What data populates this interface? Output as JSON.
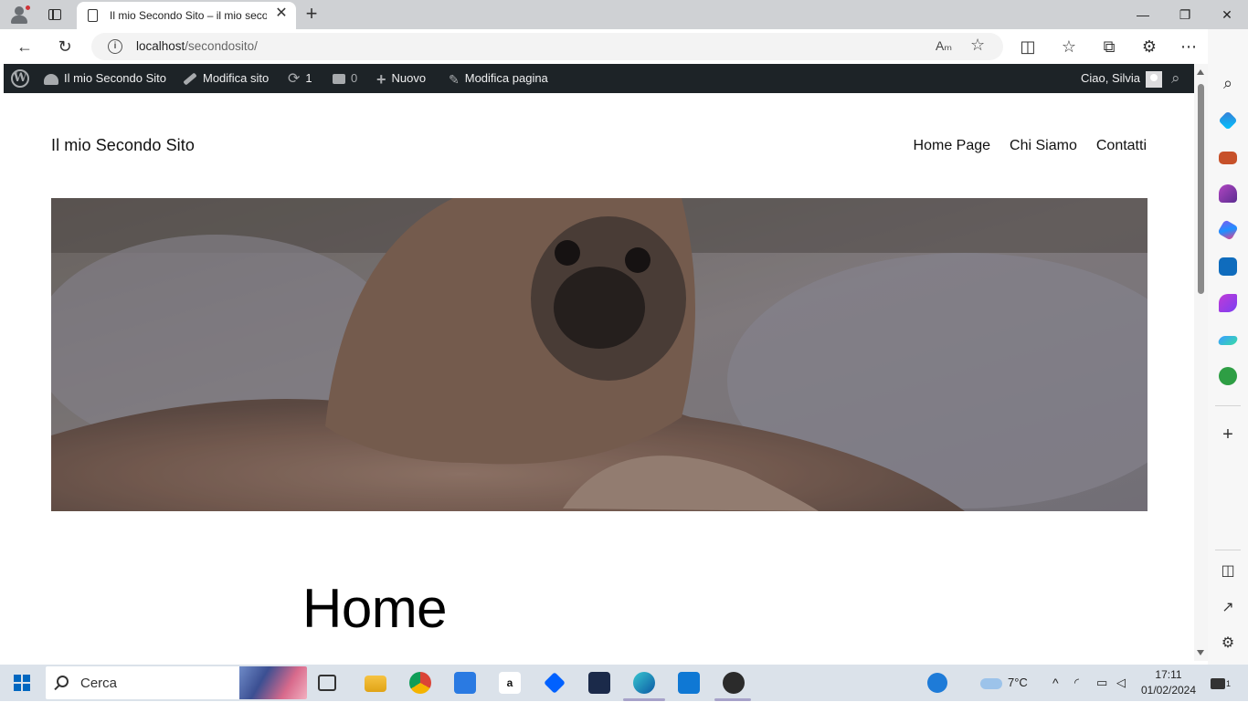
{
  "browser": {
    "tab_title": "Il mio Secondo Sito – il mio secondo sito",
    "url_host": "localhost",
    "url_path": "/secondosito/",
    "new_tab_symbol": "+",
    "close_symbol": "✕",
    "window_controls": {
      "minimize": "—",
      "maximize": "❐",
      "close": "✕"
    },
    "nav": {
      "back": "←",
      "refresh": "↻",
      "read_aloud": "Aₘ",
      "favorite": "☆"
    },
    "right_tools": {
      "split": "◫",
      "favorites": "☆",
      "collections": "⧉",
      "extensions": "⚙",
      "more": "⋯"
    }
  },
  "admin_bar": {
    "site_name": "Il mio Secondo Sito",
    "customize": "Modifica sito",
    "updates_count": "1",
    "comments_count": "0",
    "new": "Nuovo",
    "edit_page": "Modifica pagina",
    "greeting": "Ciao, Silvia",
    "icons": {
      "wp_logo": "W",
      "updates": "⟳",
      "comments": "▰",
      "new": "+",
      "edit": "✎",
      "search": "⌕"
    }
  },
  "site": {
    "title": "Il mio Secondo Sito",
    "menu": [
      "Home Page",
      "Chi Siamo",
      "Contatti"
    ],
    "page_heading": "Home",
    "hero_alt": "pug-icon"
  },
  "edge_sidebar": {
    "icons": [
      "search-icon",
      "shopping-tag-icon",
      "tools-icon",
      "games-icon",
      "microsoft365-icon",
      "outlook-icon",
      "designer-icon",
      "send-icon",
      "tree-icon"
    ],
    "add": "+",
    "bottom": {
      "panel": "◫",
      "open_external": "↗",
      "settings": "⚙"
    }
  },
  "taskbar": {
    "search_label": "Cerca",
    "weather": "7°C",
    "time": "17:11",
    "date": "01/02/2024",
    "app_icons": [
      "task-view-icon",
      "file-explorer-icon",
      "chrome-icon",
      "store-icon",
      "amazon-icon",
      "dropbox-icon",
      "powerapps-icon",
      "edge-icon",
      "mail-icon",
      "github-icon"
    ],
    "amazon_letter": "a",
    "tray": {
      "chevron": "^",
      "notification_count": "1"
    }
  },
  "colors": {
    "wp_admin_bg": "#1d2327",
    "taskbar_bg": "#dbe2ea",
    "tabstrip_bg": "#cfd1d4",
    "accent": "#0067c0"
  }
}
